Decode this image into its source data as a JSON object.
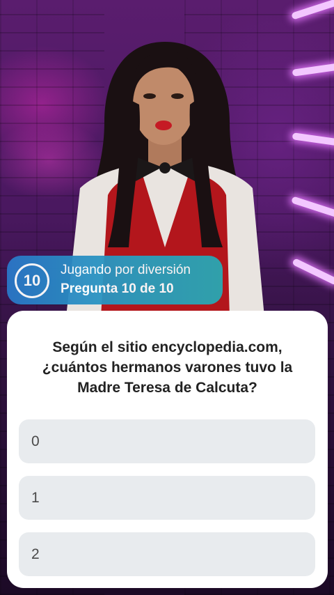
{
  "badge": {
    "round_number": "10",
    "mode_text": "Jugando por diversión",
    "progress_text": "Pregunta 10 de 10"
  },
  "question": {
    "text": "Según el sitio encyclopedia.com, ¿cuántos hermanos varones tuvo la Madre Teresa de Calcuta?"
  },
  "options": [
    {
      "label": "0"
    },
    {
      "label": "1"
    },
    {
      "label": "2"
    }
  ],
  "colors": {
    "badge_gradient_start": "#2a78c8",
    "badge_gradient_end": "#2aa8b2",
    "card_background": "#ffffff",
    "option_background": "#e8ebee",
    "question_text": "#222222"
  }
}
